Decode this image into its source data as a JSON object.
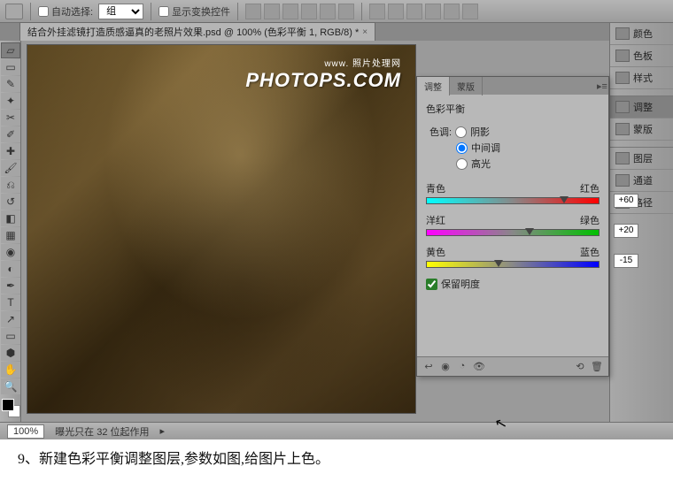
{
  "toolbar": {
    "auto_select_label": "自动选择:",
    "auto_select_value": "组",
    "show_transform_label": "显示变换控件"
  },
  "document_tab": {
    "title": "结合外挂滤镜打造质感逼真的老照片效果.psd @ 100% (色彩平衡 1, RGB/8) *",
    "close": "×"
  },
  "watermark": {
    "line1": "www.  照片处理网",
    "line2": "PHOTOPS.COM"
  },
  "adjust_panel": {
    "tabs": {
      "adjust": "调整",
      "mask": "蒙版"
    },
    "title": "色彩平衡",
    "tone_label": "色调:",
    "radios": {
      "shadow": "阴影",
      "midtone": "中间调",
      "highlight": "高光"
    },
    "sliders": {
      "cyan": "青色",
      "red": "红色",
      "red_value": "+60",
      "magenta": "洋红",
      "green": "绿色",
      "green_value": "+20",
      "yellow": "黄色",
      "blue": "蓝色",
      "blue_value": "-15"
    },
    "preserve_label": "保留明度"
  },
  "right_rail": {
    "items": [
      "颜色",
      "色板",
      "样式",
      "调整",
      "蒙版",
      "图层",
      "通道",
      "路径"
    ]
  },
  "status": {
    "zoom": "100%",
    "info": "曝光只在 32 位起作用"
  },
  "caption": "9、新建色彩平衡调整图层,参数如图,给图片上色。"
}
